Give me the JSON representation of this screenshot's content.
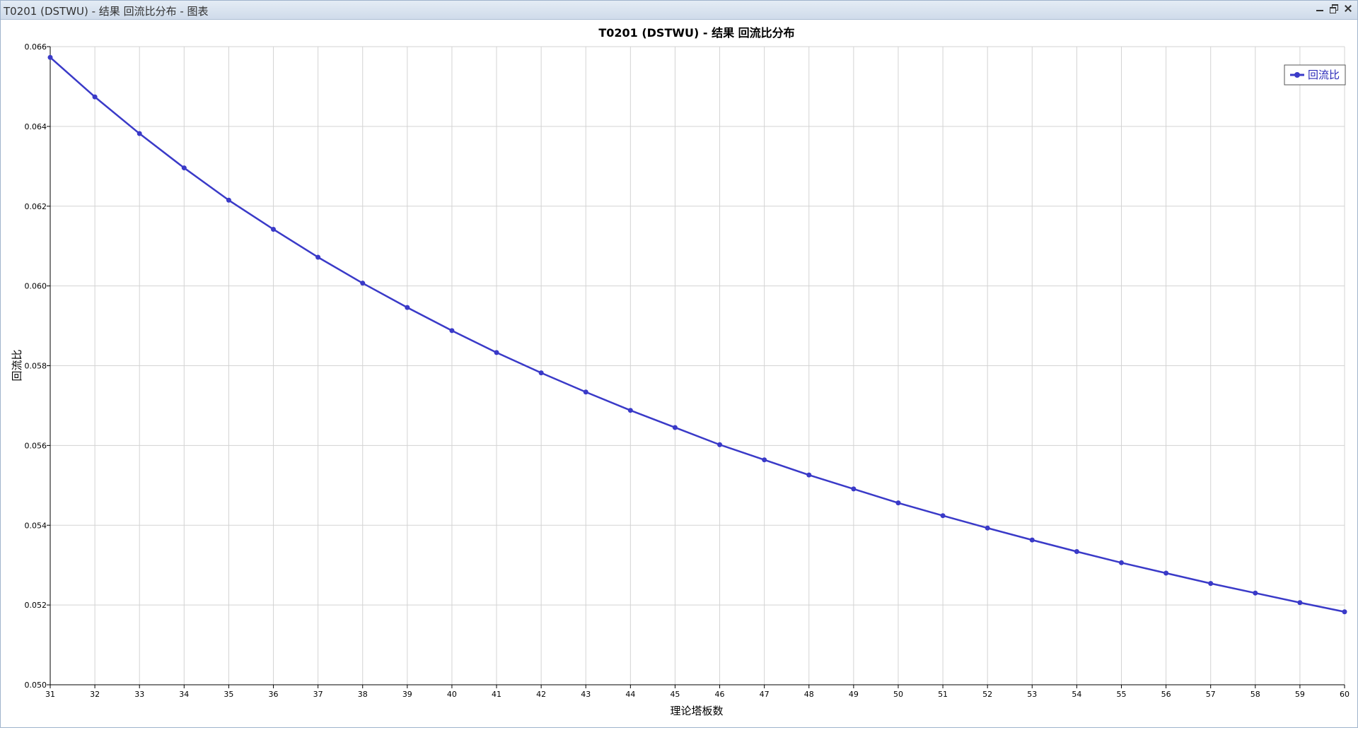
{
  "window": {
    "title": "T0201 (DSTWU) - 结果 回流比分布 - 图表"
  },
  "colors": {
    "series": "#3a3ac8",
    "grid": "#d3d3d3",
    "titlebar": "#d8e2ee"
  },
  "chart_data": {
    "type": "line",
    "title": "T0201 (DSTWU) - 结果 回流比分布",
    "xlabel": "理论塔板数",
    "ylabel": "回流比",
    "xlim": [
      31,
      60
    ],
    "ylim": [
      0.05,
      0.066
    ],
    "grid": true,
    "legend_position": "top-right",
    "x": [
      31,
      32,
      33,
      34,
      35,
      36,
      37,
      38,
      39,
      40,
      41,
      42,
      43,
      44,
      45,
      46,
      47,
      48,
      49,
      50,
      51,
      52,
      53,
      54,
      55,
      56,
      57,
      58,
      59,
      60
    ],
    "x_tick_labels": [
      "31",
      "32",
      "33",
      "34",
      "35",
      "36",
      "37",
      "38",
      "39",
      "40",
      "41",
      "42",
      "43",
      "44",
      "45",
      "46",
      "47",
      "48",
      "49",
      "50",
      "51",
      "52",
      "53",
      "54",
      "55",
      "56",
      "57",
      "58",
      "59",
      "60"
    ],
    "y_tick_labels": [
      "0.066",
      "0.064",
      "0.062",
      "0.060",
      "0.058",
      "0.056",
      "0.054",
      "0.052",
      "0.050"
    ],
    "series": [
      {
        "name": "回流比",
        "values": [
          0.06573,
          0.06474,
          0.06382,
          0.06296,
          0.06215,
          0.06142,
          0.06072,
          0.06007,
          0.05946,
          0.05888,
          0.05833,
          0.05782,
          0.05734,
          0.05688,
          0.05645,
          0.05602,
          0.05564,
          0.05526,
          0.05491,
          0.05456,
          0.05424,
          0.05393,
          0.05363,
          0.05334,
          0.05306,
          0.0528,
          0.05254,
          0.0523,
          0.05206,
          0.05183
        ]
      }
    ]
  }
}
